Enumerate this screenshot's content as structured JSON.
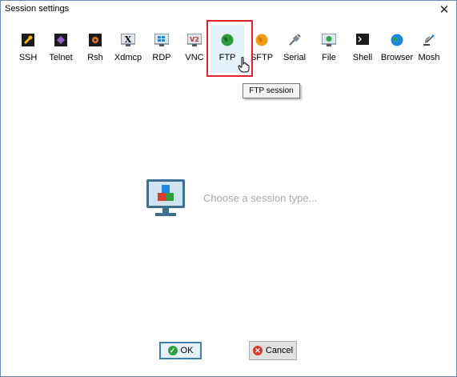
{
  "window": {
    "title": "Session settings"
  },
  "toolbar": {
    "items": [
      {
        "label": "SSH",
        "icon": "ssh-wrench-icon"
      },
      {
        "label": "Telnet",
        "icon": "telnet-icon"
      },
      {
        "label": "Rsh",
        "icon": "rsh-icon"
      },
      {
        "label": "Xdmcp",
        "icon": "xdmcp-icon"
      },
      {
        "label": "RDP",
        "icon": "rdp-icon"
      },
      {
        "label": "VNC",
        "icon": "vnc-icon"
      },
      {
        "label": "FTP",
        "icon": "ftp-globe-icon"
      },
      {
        "label": "SFTP",
        "icon": "sftp-icon"
      },
      {
        "label": "Serial",
        "icon": "serial-plug-icon"
      },
      {
        "label": "File",
        "icon": "file-monitor-icon"
      },
      {
        "label": "Shell",
        "icon": "shell-terminal-icon"
      },
      {
        "label": "Browser",
        "icon": "browser-globe-icon"
      },
      {
        "label": "Mosh",
        "icon": "mosh-satellite-icon"
      }
    ],
    "hovered": "FTP"
  },
  "tooltip": {
    "text": "FTP session"
  },
  "placeholder": {
    "text": "Choose a session type..."
  },
  "buttons": {
    "ok": "OK",
    "cancel": "Cancel"
  },
  "colors": {
    "highlight": "#e0202a",
    "accent": "#3c7fb1",
    "placeholder_text": "#a8a8a8"
  }
}
